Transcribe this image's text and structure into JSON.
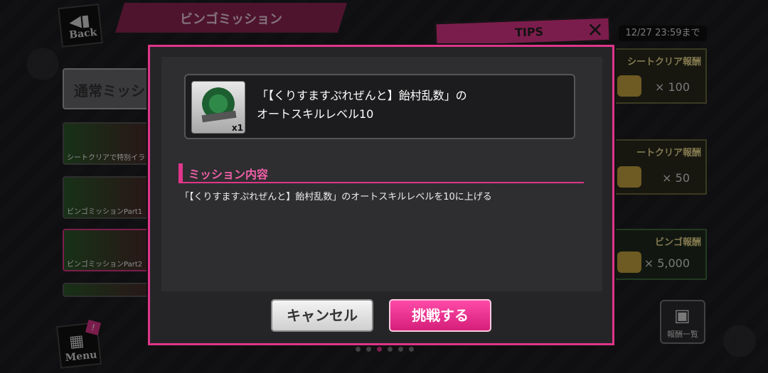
{
  "header": {
    "back_label": "Back",
    "title": "ビンゴミッション",
    "tips_label": "TIPS",
    "close_glyph": "✕",
    "deadline": "12/27 23:59まで"
  },
  "sidebar": {
    "tab_label": "通常ミッシ",
    "banners": [
      {
        "caption": "シートクリアで特別イラ"
      },
      {
        "caption": "ビンゴミッションPart1"
      },
      {
        "caption": "ビンゴミッションPart2"
      },
      {
        "caption": ""
      }
    ]
  },
  "rewards": [
    {
      "header": "シートクリア報酬",
      "value": "× 100"
    },
    {
      "header": "ートクリア報酬",
      "value": "× 50"
    },
    {
      "header": "ビンゴ報酬",
      "value": "× 5,000"
    }
  ],
  "prize_button_label": "報酬一覧",
  "menu": {
    "label": "Menu",
    "badge": "!"
  },
  "pager": {
    "count": 6,
    "active_index": 2
  },
  "modal": {
    "item": {
      "name_line1": "「【くりすますぷれぜんと】飴村乱数」の",
      "name_line2": "オートスキルレベル10",
      "quantity": "x1"
    },
    "section_title": "ミッション内容",
    "description": "「【くりすますぷれぜんと】飴村乱数」のオートスキルレベルを10に上げる",
    "cancel_label": "キャンセル",
    "challenge_label": "挑戦する"
  },
  "colors": {
    "accent": "#e0358a",
    "panel": "#2e2e31",
    "background": "#1b1b1d"
  }
}
